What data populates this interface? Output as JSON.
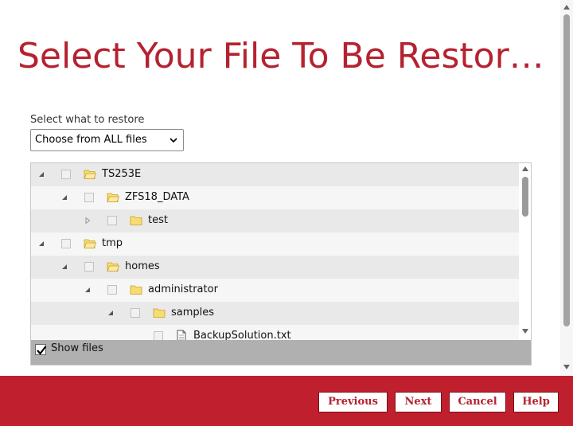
{
  "page": {
    "title": "Select Your File To Be Restor…"
  },
  "restore_selector": {
    "label": "Select what to restore",
    "selected": "Choose from ALL files"
  },
  "tree": {
    "rows": [
      {
        "label": "TS253E",
        "depth": 0,
        "expanded": true,
        "icon": "folder-open-icon"
      },
      {
        "label": "ZFS18_DATA",
        "depth": 1,
        "expanded": true,
        "icon": "folder-open-icon"
      },
      {
        "label": "test",
        "depth": 2,
        "expanded": false,
        "icon": "folder-icon"
      },
      {
        "label": "tmp",
        "depth": 0,
        "expanded": true,
        "icon": "folder-open-icon"
      },
      {
        "label": "homes",
        "depth": 1,
        "expanded": true,
        "icon": "folder-open-icon"
      },
      {
        "label": "administrator",
        "depth": 2,
        "expanded": true,
        "icon": "folder-icon"
      },
      {
        "label": "samples",
        "depth": 3,
        "expanded": true,
        "icon": "folder-icon"
      },
      {
        "label": "BackupSolution.txt",
        "depth": 4,
        "expanded": null,
        "icon": "file-icon"
      }
    ]
  },
  "show_files": {
    "label": "Show files",
    "checked": true
  },
  "footer": {
    "previous_label": "Previous",
    "next_label": "Next",
    "cancel_label": "Cancel",
    "help_label": "Help"
  },
  "colors": {
    "brand_red": "#c0202e",
    "title_red": "#b5222f",
    "folder_yellow": "#f7dc6f"
  }
}
